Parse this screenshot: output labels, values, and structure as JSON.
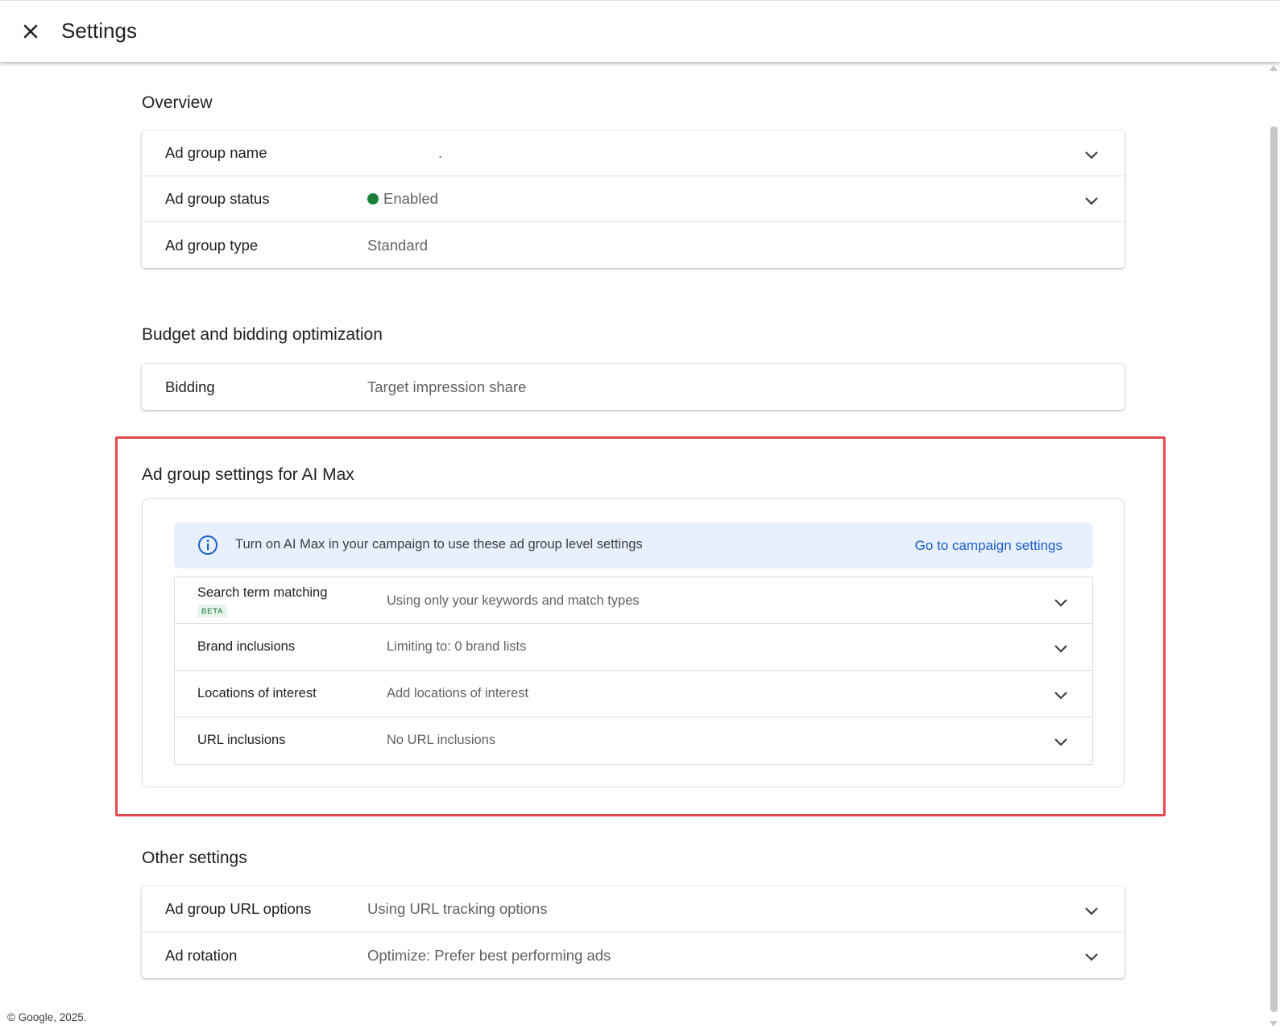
{
  "header": {
    "title": "Settings",
    "close_icon": "close-icon"
  },
  "overview": {
    "title": "Overview",
    "rows": [
      {
        "label": "Ad group name",
        "value": ".",
        "expandable": true
      },
      {
        "label": "Ad group status",
        "value": "Enabled",
        "status_color": "#188038",
        "expandable": true
      },
      {
        "label": "Ad group type",
        "value": "Standard",
        "expandable": false
      }
    ]
  },
  "budget": {
    "title": "Budget and bidding optimization",
    "rows": [
      {
        "label": "Bidding",
        "value": "Target impression share",
        "expandable": false
      }
    ]
  },
  "ai_max": {
    "title": "Ad group settings for AI Max",
    "banner": {
      "icon": "info-icon",
      "text": "Turn on AI Max in your campaign to use these ad group level settings",
      "link": "Go to campaign settings"
    },
    "rows": [
      {
        "label": "Search term matching",
        "badge": "BETA",
        "value": "Using only your keywords and match types"
      },
      {
        "label": "Brand inclusions",
        "value": "Limiting to: 0 brand lists"
      },
      {
        "label": "Locations of interest",
        "value": "Add locations of interest"
      },
      {
        "label": "URL inclusions",
        "value": "No URL inclusions"
      }
    ],
    "highlight_color": "#e34a4f"
  },
  "other": {
    "title": "Other settings",
    "rows": [
      {
        "label": "Ad group URL options",
        "value": "Using URL tracking options",
        "expandable": true
      },
      {
        "label": "Ad rotation",
        "value": "Optimize: Prefer best performing ads",
        "expandable": true
      }
    ]
  },
  "footer": {
    "text": "© Google, 2025."
  }
}
